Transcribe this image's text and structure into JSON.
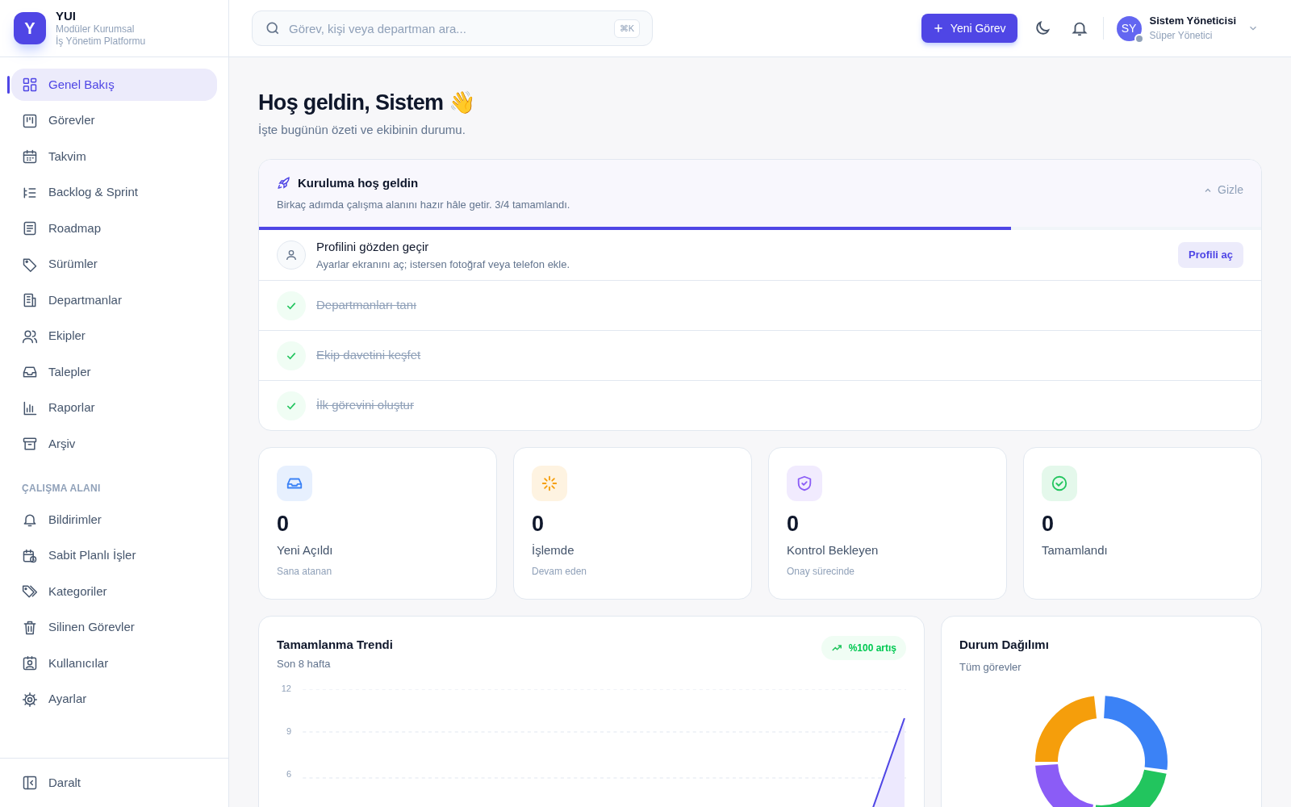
{
  "brand": {
    "logo_letter": "Y",
    "name": "YUI",
    "tagline": [
      "Modüler Kurumsal",
      "İş Yönetim Platformu"
    ]
  },
  "nav": [
    {
      "label": "Genel Bakış",
      "selected": true
    },
    {
      "label": "Görevler",
      "selected": false
    },
    {
      "label": "Takvim",
      "selected": false
    },
    {
      "label": "Backlog & Sprint",
      "selected": false
    },
    {
      "label": "Roadmap",
      "selected": false
    },
    {
      "label": "Sürümler",
      "selected": false
    },
    {
      "label": "Departmanlar",
      "selected": false
    },
    {
      "label": "Ekipler",
      "selected": false
    },
    {
      "label": "Talepler",
      "selected": false
    },
    {
      "label": "Raporlar",
      "selected": false
    },
    {
      "label": "Arşiv",
      "selected": false
    }
  ],
  "workspace": {
    "heading": "ÇALIŞMA ALANI",
    "items": [
      {
        "label": "Bildirimler",
        "selected": false
      },
      {
        "label": "Sabit Planlı İşler",
        "selected": false
      },
      {
        "label": "Kategoriler",
        "selected": false
      },
      {
        "label": "Silinen Görevler",
        "selected": false
      },
      {
        "label": "Kullanıcılar",
        "selected": false
      },
      {
        "label": "Ayarlar",
        "selected": false
      }
    ]
  },
  "collapse": "Daralt",
  "header": {
    "search": {
      "placeholder": "Görev, kişi veya departman ara...",
      "shortcut": "⌘K"
    },
    "new_button": "Yeni Görev",
    "user": {
      "initials": "SY",
      "name": "Sistem Yöneticisi",
      "role": "Süper Yönetici"
    }
  },
  "greeting": {
    "title": "Hoş geldin, Sistem 👋",
    "subtitle": "İşte bugünün özeti ve ekibinin durumu."
  },
  "setup": {
    "title": "Kuruluma hoş geldin",
    "subtitle": "Birkaç adımda çalışma alanını hazır hâle getir. 3/4 tamamlandı.",
    "hide": "Gizle",
    "level": 0.75,
    "steps": [
      {
        "title": "Profilini gözden geçir",
        "description": "Ayarlar ekranını aç; istersen fotoğraf veya telefon ekle.",
        "action": "Profili aç",
        "done": false
      },
      {
        "title": "Departmanları tanı",
        "done": true
      },
      {
        "title": "Ekip davetini keşfet",
        "done": true
      },
      {
        "title": "İlk görevini oluştur",
        "done": true
      }
    ]
  },
  "stats": [
    {
      "value": "0",
      "label": "Yeni Açıldı",
      "sub": "Sana atanan",
      "color": "#3b82f6"
    },
    {
      "value": "0",
      "label": "İşlemde",
      "sub": "Devam eden",
      "color": "#f59e0b"
    },
    {
      "value": "0",
      "label": "Kontrol Bekleyen",
      "sub": "Onay sürecinde",
      "color": "#8b5cf6"
    },
    {
      "value": "0",
      "label": "Tamamlandı",
      "color": "#22c55e"
    }
  ],
  "trend": {
    "title": "Tamamlanma Trendi",
    "subtitle": "Son 8 hafta",
    "badge": "%100 artış",
    "axis_labels": [
      "12",
      "9",
      "6"
    ]
  },
  "distribution": {
    "title": "Durum Dağılımı",
    "subtitle": "Tüm görevler"
  }
}
